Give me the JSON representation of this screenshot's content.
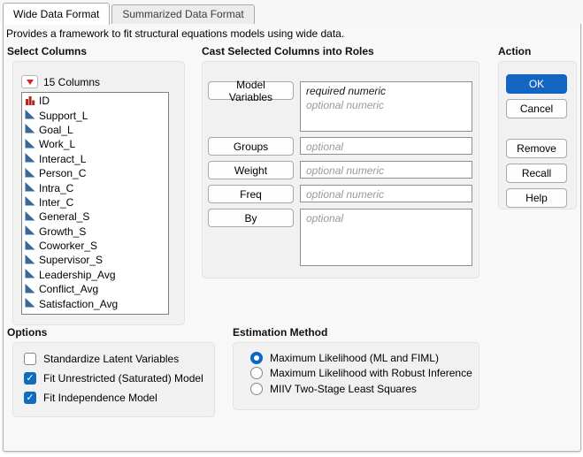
{
  "window": {
    "tabs": [
      {
        "label": "Wide Data Format",
        "active": true
      },
      {
        "label": "Summarized Data Format",
        "active": false
      }
    ],
    "description": "Provides a framework to fit structural equations models using wide data."
  },
  "select_columns": {
    "title": "Select Columns",
    "columns_menu_label": "15 Columns",
    "menu_icon": "red-triangle-icon",
    "items": [
      {
        "name": "ID",
        "icon": "nominal-bars-icon"
      },
      {
        "name": "Support_L",
        "icon": "continuous-icon"
      },
      {
        "name": "Goal_L",
        "icon": "continuous-icon"
      },
      {
        "name": "Work_L",
        "icon": "continuous-icon"
      },
      {
        "name": "Interact_L",
        "icon": "continuous-icon"
      },
      {
        "name": "Person_C",
        "icon": "continuous-icon"
      },
      {
        "name": "Intra_C",
        "icon": "continuous-icon"
      },
      {
        "name": "Inter_C",
        "icon": "continuous-icon"
      },
      {
        "name": "General_S",
        "icon": "continuous-icon"
      },
      {
        "name": "Growth_S",
        "icon": "continuous-icon"
      },
      {
        "name": "Coworker_S",
        "icon": "continuous-icon"
      },
      {
        "name": "Supervisor_S",
        "icon": "continuous-icon"
      },
      {
        "name": "Leadership_Avg",
        "icon": "continuous-icon"
      },
      {
        "name": "Conflict_Avg",
        "icon": "continuous-icon"
      },
      {
        "name": "Satisfaction_Avg",
        "icon": "continuous-icon"
      }
    ]
  },
  "cast_roles": {
    "title": "Cast Selected Columns into Roles",
    "roles": [
      {
        "button": "Model Variables",
        "placeholders": [
          {
            "text": "required numeric",
            "required": true
          },
          {
            "text": "optional numeric",
            "required": false
          }
        ]
      },
      {
        "button": "Groups",
        "placeholders": [
          {
            "text": "optional",
            "required": false
          }
        ]
      },
      {
        "button": "Weight",
        "placeholders": [
          {
            "text": "optional numeric",
            "required": false
          }
        ]
      },
      {
        "button": "Freq",
        "placeholders": [
          {
            "text": "optional numeric",
            "required": false
          }
        ]
      },
      {
        "button": "By",
        "placeholders": [
          {
            "text": "optional",
            "required": false
          }
        ]
      }
    ]
  },
  "action": {
    "title": "Action",
    "primary_buttons": [
      {
        "label": "OK",
        "accent": true
      },
      {
        "label": "Cancel",
        "accent": false
      }
    ],
    "secondary_buttons": [
      {
        "label": "Remove",
        "accent": false
      },
      {
        "label": "Recall",
        "accent": false
      },
      {
        "label": "Help",
        "accent": false
      }
    ]
  },
  "options": {
    "title": "Options",
    "checkboxes": [
      {
        "label": "Standardize Latent Variables",
        "checked": false
      },
      {
        "label": "Fit Unrestricted (Saturated) Model",
        "checked": true
      },
      {
        "label": "Fit Independence Model",
        "checked": true
      }
    ]
  },
  "estimation": {
    "title": "Estimation Method",
    "radios": [
      {
        "label": "Maximum Likelihood (ML and FIML)",
        "selected": true
      },
      {
        "label": "Maximum Likelihood with Robust Inference",
        "selected": false
      },
      {
        "label": "MIIV Two-Stage Least Squares",
        "selected": false
      }
    ]
  },
  "colors": {
    "accent_blue": "#1465c2",
    "checkbox_blue": "#0f6cbd",
    "radio_blue": "#0d66c2",
    "continuous_icon_blue": "#36689b",
    "nominal_icon_red": "#b5271d",
    "menu_triangle_red": "#d02b20",
    "check_glyph": "✓"
  }
}
